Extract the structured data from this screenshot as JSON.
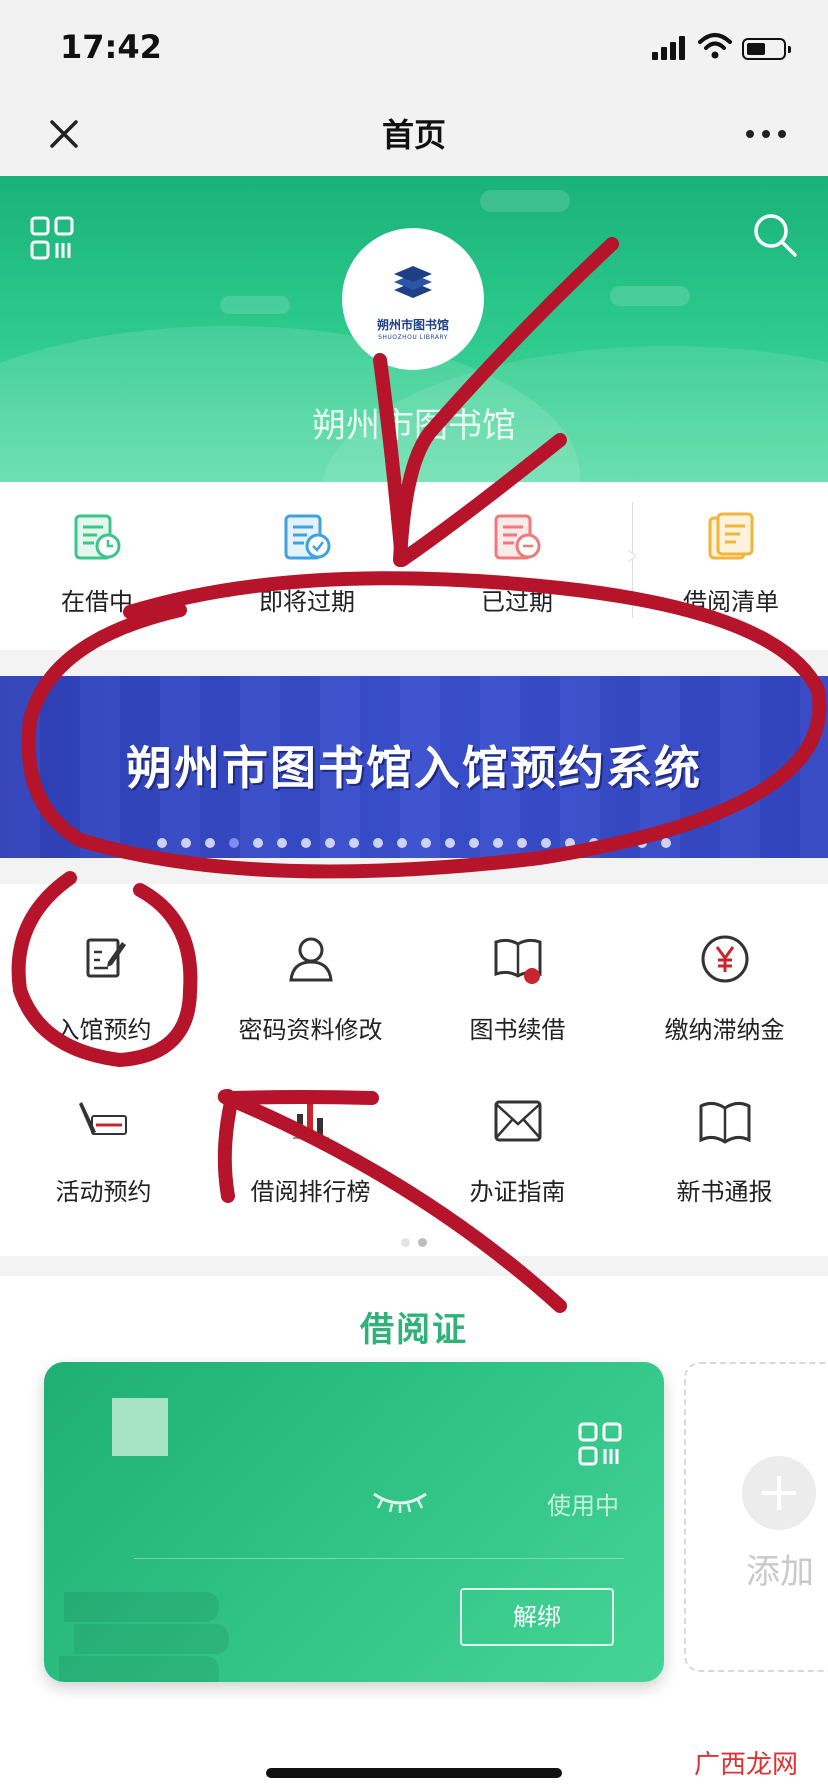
{
  "status_bar": {
    "time": "17:42"
  },
  "nav": {
    "title": "首页"
  },
  "header": {
    "library_name": "朔州市图书馆",
    "logo_text": "朔州市图书馆",
    "logo_subtext": "SHUOZHOU LIBRARY"
  },
  "stats": [
    {
      "label": "在借中",
      "color": "#3cc48a"
    },
    {
      "label": "即将过期",
      "color": "#3fa2e0"
    },
    {
      "label": "已过期",
      "color": "#f07a7a"
    },
    {
      "label": "借阅清单",
      "color": "#f2b43a"
    }
  ],
  "banner": {
    "text": "朔州市图书馆入馆预约系统",
    "dot_count": 22,
    "active_dot": 3
  },
  "grid": [
    {
      "label": "入馆预约",
      "icon": "edit-form-icon"
    },
    {
      "label": "密码资料修改",
      "icon": "user-profile-icon"
    },
    {
      "label": "图书续借",
      "icon": "book-renew-icon"
    },
    {
      "label": "缴纳滞纳金",
      "icon": "yen-coin-icon"
    },
    {
      "label": "活动预约",
      "icon": "sign-up-icon"
    },
    {
      "label": "借阅排行榜",
      "icon": "ranking-chart-icon"
    },
    {
      "label": "办证指南",
      "icon": "envelope-icon"
    },
    {
      "label": "新书通报",
      "icon": "open-book-icon"
    }
  ],
  "card_section": {
    "title": "借阅证",
    "card": {
      "status": "使用中",
      "unbind_label": "解绑"
    },
    "add_label": "添加"
  },
  "watermark": "广西龙网",
  "colors": {
    "brand_green": "#2fc385",
    "banner_blue": "#3a4fcf",
    "annotation_red": "#b5142b"
  }
}
